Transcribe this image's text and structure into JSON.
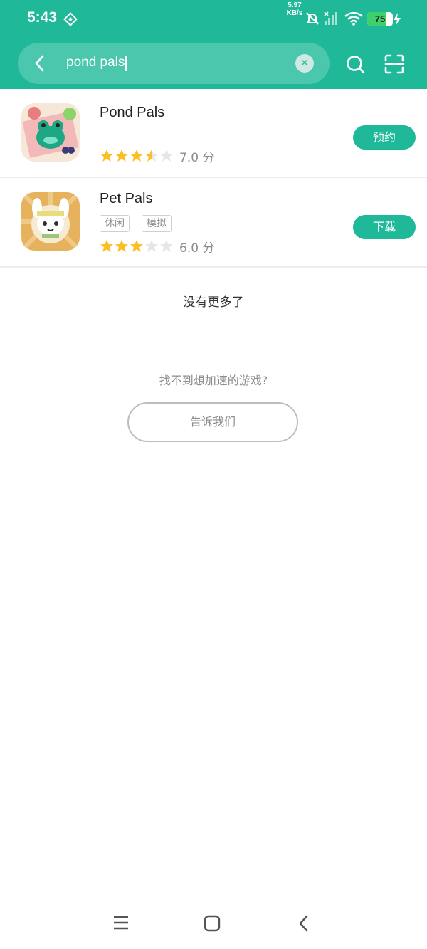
{
  "status_bar": {
    "time": "5:43",
    "net_speed_value": "5.97",
    "net_speed_unit": "KB/s",
    "battery": "75",
    "battery_fraction": 0.75
  },
  "search": {
    "query": "pond pals",
    "back_icon": "chevron-left-icon",
    "clear_icon": "close-icon",
    "search_icon": "search-icon",
    "scan_icon": "scan-icon"
  },
  "results": [
    {
      "name": "Pond Pals",
      "tags": [],
      "rating_stars": 3.5,
      "rating_text": "7.0 分",
      "action": "预约"
    },
    {
      "name": "Pet Pals",
      "tags": [
        "休闲",
        "模拟"
      ],
      "rating_stars": 3,
      "rating_text": "6.0 分",
      "action": "下载"
    }
  ],
  "footer": {
    "no_more": "没有更多了",
    "not_found": "找不到想加速的游戏?",
    "tell_us": "告诉我们"
  },
  "colors": {
    "accent": "#1fb99a",
    "star": "#fbbf24",
    "star_empty": "#e6e6e6"
  }
}
